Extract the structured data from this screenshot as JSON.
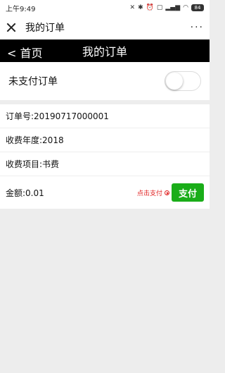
{
  "status_bar": {
    "time": "上午9:49",
    "battery": "84"
  },
  "wechat_header": {
    "title": "我的订单",
    "more": "···"
  },
  "page_header": {
    "back_label": "< 首页",
    "title": "我的订单"
  },
  "filter": {
    "unpaid_label": "未支付订单",
    "unpaid_toggle_on": false
  },
  "order": {
    "number_label": "订单号:",
    "number": "20190717000001",
    "year_label": "收费年度:",
    "year": "2018",
    "item_label": "收费项目:",
    "item": "书费",
    "amount_label": "金额:",
    "amount": "0.01",
    "pay_hint": "点击支付",
    "pay_button": "支付"
  },
  "colors": {
    "pay_green": "#1aad19",
    "hint_red": "#e02020",
    "header_black": "#000000"
  }
}
